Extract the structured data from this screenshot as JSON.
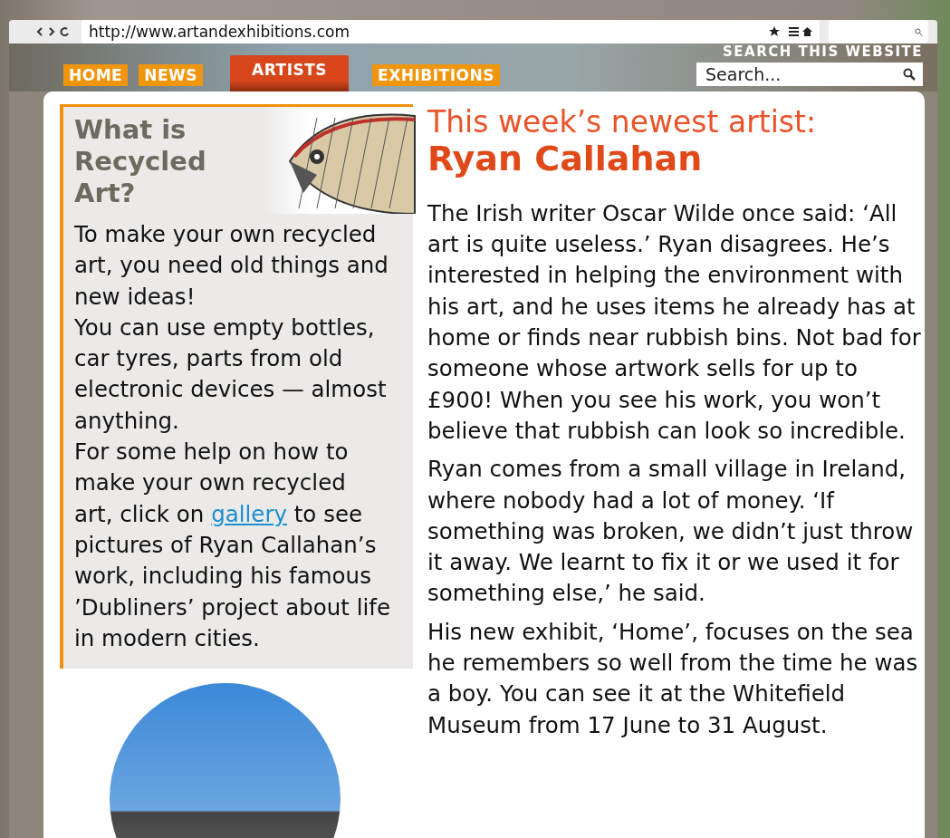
{
  "browser": {
    "url": "http://www.artandexhibitions.com"
  },
  "nav": {
    "tabs": [
      {
        "label": "HOME",
        "selected": false
      },
      {
        "label": "NEWS",
        "selected": false
      },
      {
        "label": "ARTISTS",
        "selected": true
      },
      {
        "label": "EXHIBITIONS",
        "selected": false
      }
    ],
    "search": {
      "label": "SEARCH THIS WEBSITE",
      "placeholder": "Search..."
    }
  },
  "sidebar": {
    "title": "What is Recycled Art?",
    "paragraphs": [
      {
        "text": "To make your own recycled art, you need old things and new ideas!"
      },
      {
        "text": "You can use empty bottles, car tyres, parts from old electronic devices — almost anything."
      },
      {
        "text": "For some help on how to make your own recycled",
        "link": "gallery",
        "before_link": "art, click on",
        "after_link": "to see pictures of Ryan Callahan’s work, including his famous ’Dubliners’ project about life in modern cities."
      }
    ]
  },
  "article": {
    "kicker": "This week’s newest artist:",
    "title": "Ryan Callahan",
    "paragraphs": [
      "The Irish writer Oscar Wilde once said: ‘All art is quite useless.’ Ryan disagrees. He’s interested in helping the environment with his art, and he uses items he already has at home or finds near rubbish bins. Not bad for someone whose artwork sells for up to £900! When you see his work, you won’t believe that rubbish can look so incredible.",
      "Ryan comes from a small village in Ireland, where nobody had a lot of money. ‘If something was broken, we didn’t just throw it away. We learnt to fix it or we used it for something else,’ he said.",
      "His new exhibit, ‘Home’, focuses on the sea he remembers so well from the time he was a boy. You can see it at the Whitefield Museum from 17 June to 31 August."
    ]
  }
}
